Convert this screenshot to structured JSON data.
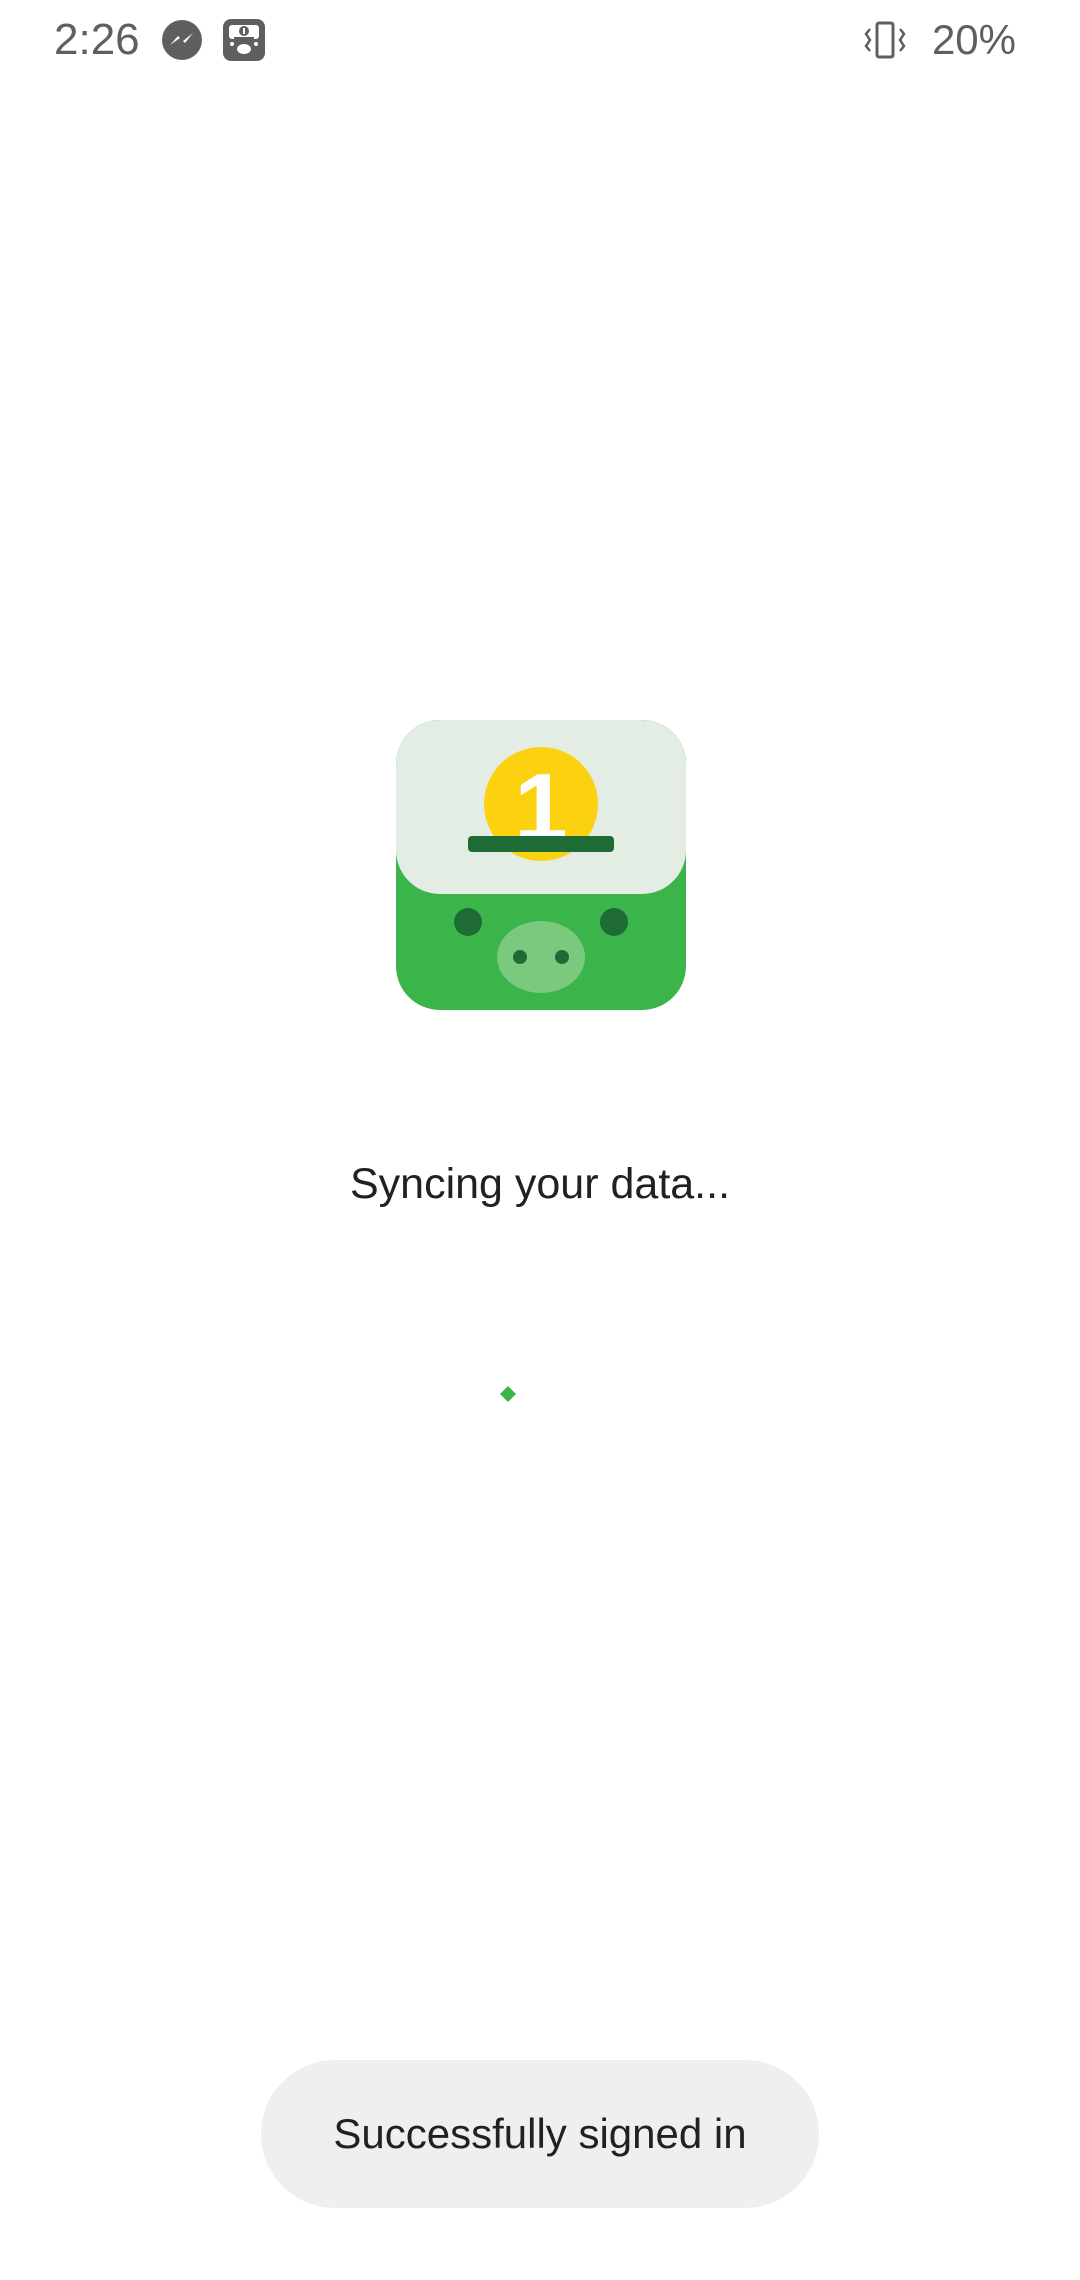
{
  "status_bar": {
    "time": "2:26",
    "battery": "20%",
    "notification_icons": [
      "messenger-icon",
      "piggy-bank-app-icon"
    ],
    "system_icons": [
      "vibrate-icon"
    ]
  },
  "main": {
    "logo_icon": "piggy-bank-coin-icon",
    "logo_coin_number": "1",
    "sync_message": "Syncing your data...",
    "progress_indicator": "spinner"
  },
  "toast": {
    "message": "Successfully signed in"
  },
  "colors": {
    "brand_green": "#3BB54A",
    "dark_green": "#1E6B35",
    "coin_yellow": "#FCD10F",
    "logo_top": "#E3EDE4",
    "toast_bg": "#EFEFEF"
  }
}
